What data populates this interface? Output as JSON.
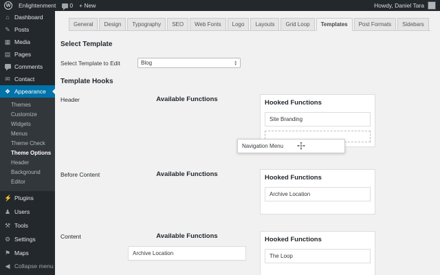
{
  "colors": {
    "admin_accent": "#0073aa",
    "sidebar_bg": "#23282d",
    "submenu_bg": "#32373c",
    "content_bg": "#f1f1f1"
  },
  "admin_bar": {
    "wp_logo": "W",
    "site_name": "Enlightenment",
    "comments_count": "0",
    "new_label": "+ New",
    "howdy": "Howdy, Daniel Tara"
  },
  "sidebar": {
    "top_items": [
      {
        "label": "Dashboard",
        "icon": "⌂"
      },
      {
        "label": "Posts",
        "icon": "✎"
      },
      {
        "label": "Media",
        "icon": "▦"
      },
      {
        "label": "Pages",
        "icon": "▤"
      },
      {
        "label": "Comments",
        "icon": "css-bubble"
      },
      {
        "label": "Contact",
        "icon": "✉"
      }
    ],
    "appearance": {
      "label": "Appearance",
      "icon": "❖"
    },
    "appearance_submenu": [
      {
        "label": "Themes"
      },
      {
        "label": "Customize"
      },
      {
        "label": "Widgets"
      },
      {
        "label": "Menus"
      },
      {
        "label": "Theme Check"
      },
      {
        "label": "Theme Options"
      },
      {
        "label": "Header"
      },
      {
        "label": "Background"
      },
      {
        "label": "Editor"
      }
    ],
    "active_submenu_item": "Theme Options",
    "bottom_items": [
      {
        "label": "Plugins",
        "icon": "⚡"
      },
      {
        "label": "Users",
        "icon": "♟"
      },
      {
        "label": "Tools",
        "icon": "⚒"
      },
      {
        "label": "Settings",
        "icon": "⚙"
      },
      {
        "label": "Maps",
        "icon": "⚑"
      }
    ],
    "collapse": {
      "label": "Collapse menu",
      "icon": "◀"
    }
  },
  "tabs": {
    "items": [
      "General",
      "Design",
      "Typography",
      "SEO",
      "Web Fonts",
      "Logo",
      "Layouts",
      "Grid Loop",
      "Templates",
      "Post Formats",
      "Sidebars"
    ],
    "active": "Templates"
  },
  "template_editor": {
    "select_heading": "Select Template",
    "select_label": "Select Template to Edit",
    "select_value": "Blog",
    "hooks_heading": "Template Hooks",
    "available_title": "Available Functions",
    "hooked_title": "Hooked Functions",
    "sections": [
      {
        "label": "Header",
        "available_items": [],
        "hooked_items": [
          "Site Branding"
        ]
      },
      {
        "label": "Before Content",
        "available_items": [],
        "hooked_items": [
          "Archive Location"
        ]
      },
      {
        "label": "Content",
        "available_items": [
          "Archive Location"
        ],
        "hooked_items": [
          "The Loop"
        ]
      }
    ],
    "dragging_item": "Navigation Menu"
  }
}
